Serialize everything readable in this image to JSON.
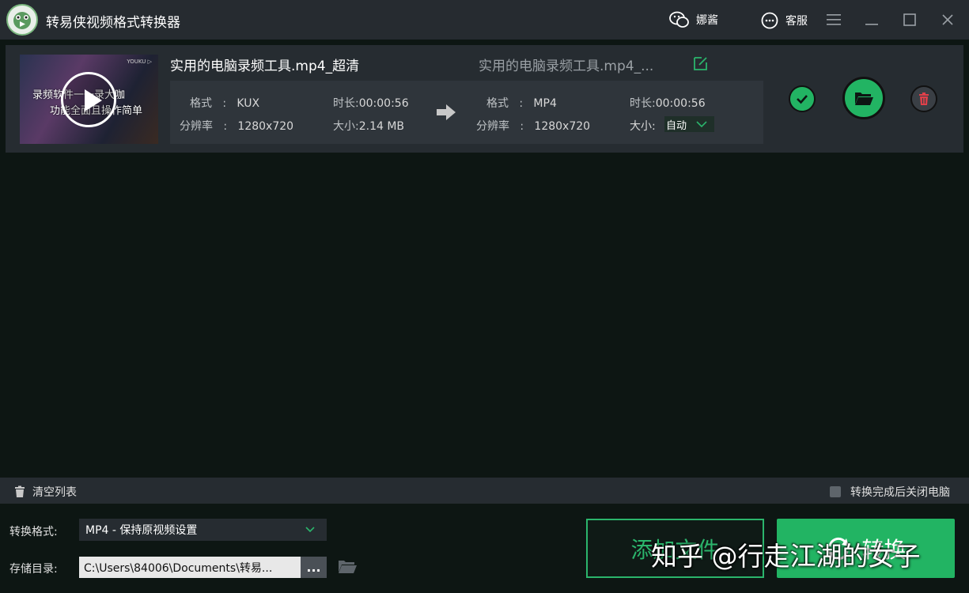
{
  "app": {
    "title": "转易侠视频格式转换器",
    "user_name": "娜酱",
    "service_label": "客服"
  },
  "file": {
    "source_name": "实用的电脑录频工具.mp4_超清",
    "output_name": "实用的电脑录频工具.mp4_...",
    "thumbnail_text_line1": "录频软件一一录大咖",
    "thumbnail_text_line2": "功能全面且操作简单",
    "thumbnail_brand": "YOUKU ▷",
    "source": {
      "format_label": "格式",
      "format": "KUX",
      "resolution_label": "分辨率",
      "resolution": "1280x720",
      "duration_label": "时长:",
      "duration": "00:00:56",
      "size_label": "大小:",
      "size": "2.14 MB"
    },
    "output": {
      "format_label": "格式",
      "format": "MP4",
      "resolution_label": "分辨率",
      "resolution": "1280x720",
      "duration_label": "时长:",
      "duration": "00:00:56",
      "size_label": "大小:",
      "size": "自动"
    }
  },
  "toolbar": {
    "clear_label": "清空列表",
    "shutdown_label": "转换完成后关闭电脑"
  },
  "settings": {
    "format_label": "转换格式:",
    "format_value": "MP4 - 保持原视频设置",
    "dir_label": "存储目录:",
    "dir_value": "C:\\Users\\84006\\Documents\\转易...",
    "browse_label": "..."
  },
  "actions": {
    "add_file_label": "添加文件",
    "convert_label": "转换"
  },
  "watermark": "知乎 @行走江湖的女子",
  "colors": {
    "accent": "#22b463",
    "background": "#0d1613",
    "panel": "#262c31"
  }
}
